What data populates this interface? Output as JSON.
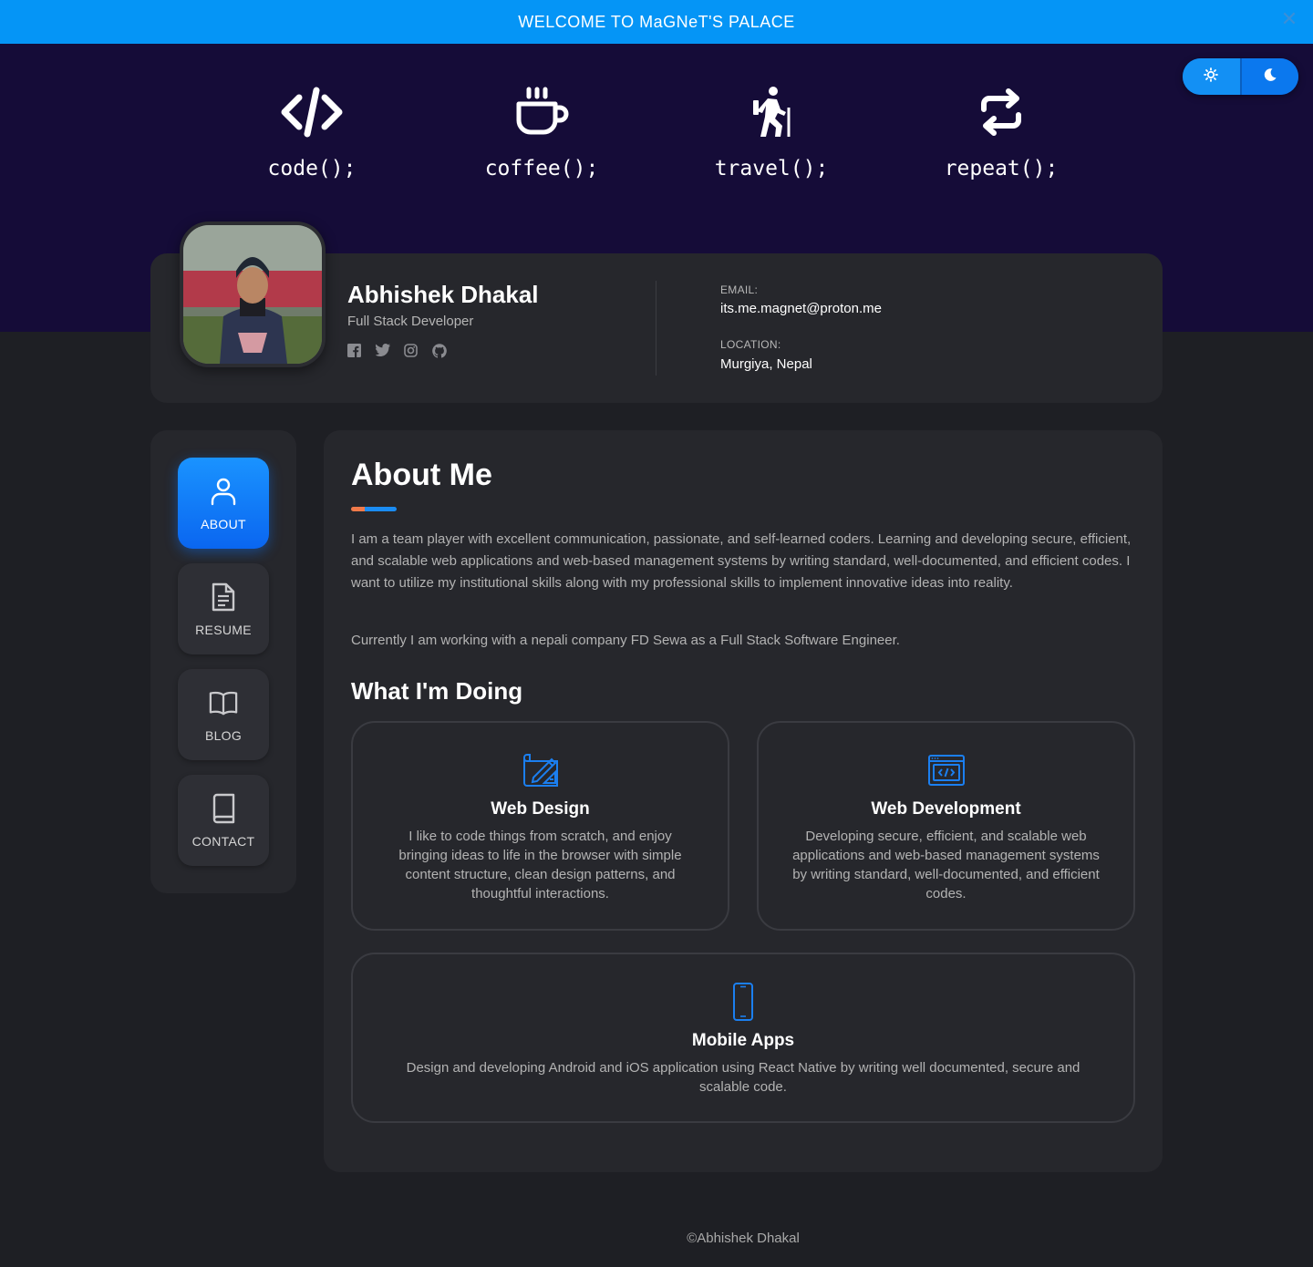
{
  "banner": {
    "text": "WELCOME TO MaGNeT'S PALACE",
    "close_icon": "close-icon"
  },
  "theme_toggle": {
    "light_icon": "sun-icon",
    "dark_icon": "moon-icon"
  },
  "hero": {
    "items": [
      {
        "icon": "code-icon",
        "label": "code();"
      },
      {
        "icon": "coffee-icon",
        "label": "coffee();"
      },
      {
        "icon": "hiking-icon",
        "label": "travel();"
      },
      {
        "icon": "repeat-icon",
        "label": "repeat();"
      }
    ]
  },
  "profile": {
    "name": "Abhishek Dhakal",
    "role": "Full Stack Developer",
    "socials": [
      "facebook-icon",
      "twitter-icon",
      "instagram-icon",
      "github-icon"
    ],
    "email_label": "EMAIL:",
    "email": "its.me.magnet@proton.me",
    "location_label": "LOCATION:",
    "location": "Murgiya, Nepal"
  },
  "nav": [
    {
      "label": "ABOUT",
      "icon": "user-icon",
      "active": true
    },
    {
      "label": "RESUME",
      "icon": "document-icon",
      "active": false
    },
    {
      "label": "BLOG",
      "icon": "open-book-icon",
      "active": false
    },
    {
      "label": "CONTACT",
      "icon": "book-icon",
      "active": false
    }
  ],
  "about": {
    "title": "About Me",
    "paragraph1": "I am a team player with excellent communication, passionate, and self-learned coders. Learning and developing secure, efficient, and scalable web applications and web-based management systems by writing standard, well-documented, and efficient codes. I want to utilize my institutional skills along with my professional skills to implement innovative ideas into reality.",
    "paragraph2": "Currently I am working with a nepali company FD Sewa as a Full Stack Software Engineer.",
    "doing_title": "What I'm Doing",
    "services": [
      {
        "icon": "design-icon",
        "title": "Web Design",
        "text": "I like to code things from scratch, and enjoy bringing ideas to life in the browser with simple content structure, clean design patterns, and thoughtful interactions."
      },
      {
        "icon": "web-dev-icon",
        "title": "Web Development",
        "text": "Developing secure, efficient, and scalable web applications and web-based management systems by writing standard, well-documented, and efficient codes."
      },
      {
        "icon": "mobile-icon",
        "title": "Mobile Apps",
        "text": "Design and developing Android and iOS application using React Native by writing well documented, secure and scalable code."
      }
    ]
  },
  "footer": {
    "text": "©Abhishek Dhakal"
  },
  "colors": {
    "accent": "#0595f6",
    "hero_bg": "#150c38",
    "card_bg": "#26272c",
    "page_bg": "#1e1f24",
    "icon_blue": "#1b7ff0"
  }
}
